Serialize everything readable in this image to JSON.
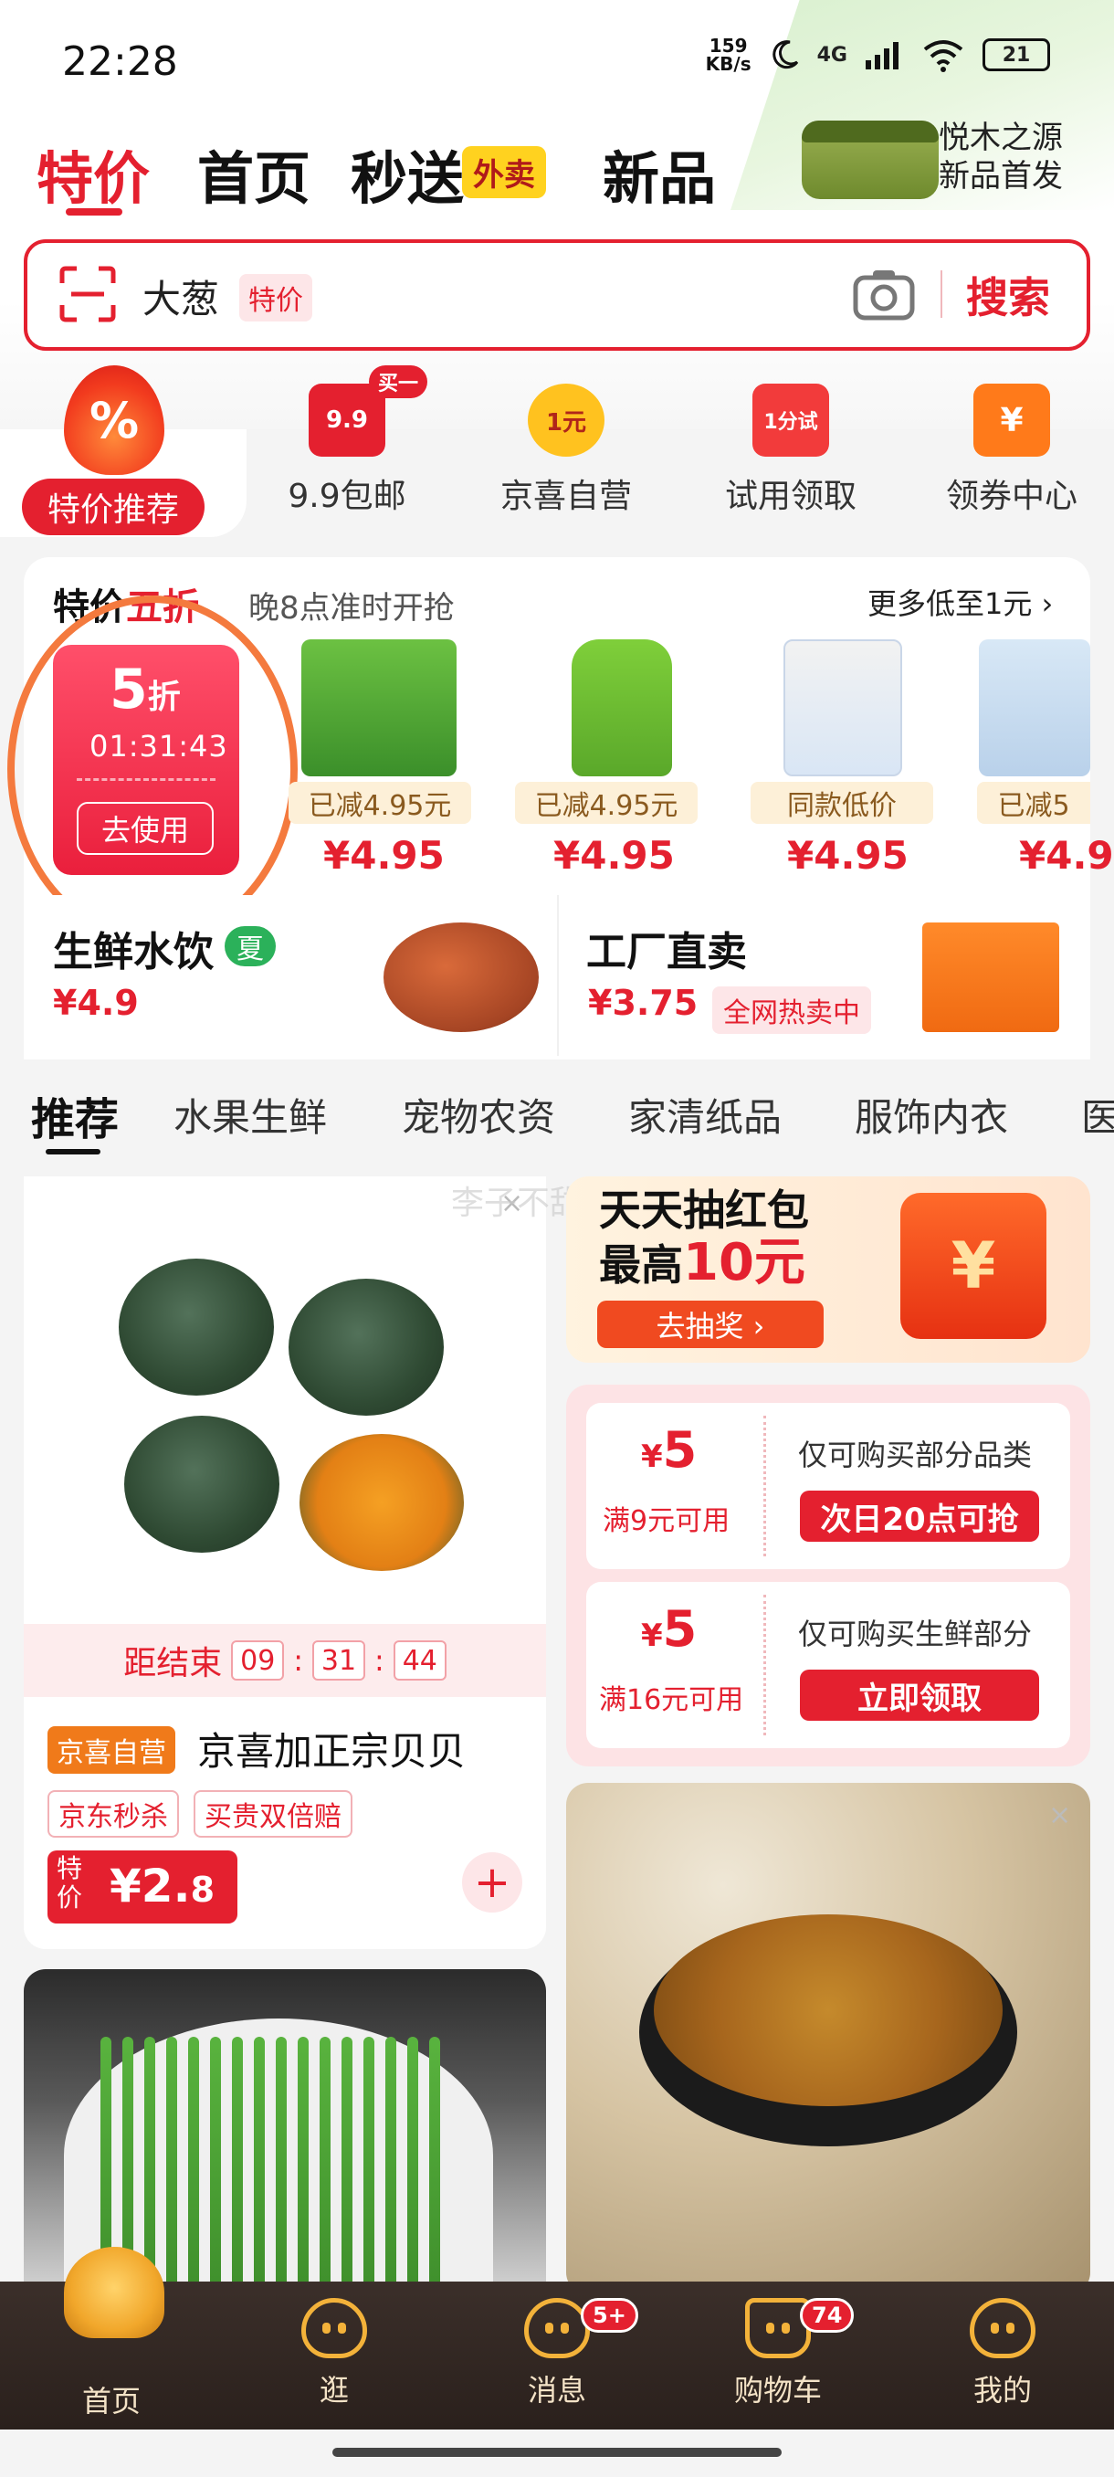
{
  "status_bar": {
    "time": "22:28",
    "speed_value": "159",
    "speed_unit": "KB/s",
    "network": "4G",
    "battery": "21"
  },
  "top_tabs": [
    {
      "label": "特价"
    },
    {
      "label": "首页"
    },
    {
      "label": "秒送"
    },
    {
      "label": "新品"
    }
  ],
  "takeout_badge": "外卖",
  "promo": {
    "line1": "悦木之源",
    "line2": "新品首发"
  },
  "search": {
    "value": "大葱",
    "chip": "特价",
    "button": "搜索"
  },
  "categories": [
    {
      "label": "特价推荐",
      "icon": "flame-percent-icon",
      "icon_text": "%"
    },
    {
      "label": "9.9包邮",
      "icon": "nine-nine-icon",
      "icon_text": "9.9",
      "badge": "买一"
    },
    {
      "label": "京喜自营",
      "icon": "one-yuan-icon",
      "icon_text": "1元"
    },
    {
      "label": "试用领取",
      "icon": "trial-bag-icon",
      "icon_text": "1分试"
    },
    {
      "label": "领券中心",
      "icon": "coupon-center-icon",
      "icon_text": "¥"
    }
  ],
  "flash": {
    "title_black": "特价",
    "title_red": "五折",
    "subtitle": "晚8点准时开抢",
    "more": "更多低至1元 ›",
    "coupon": {
      "discount": "5",
      "discount_unit": "折",
      "timer": "01:31:43",
      "button": "去使用"
    },
    "products": [
      {
        "tag": "已减4.95元",
        "price": "¥4.95",
        "icon": "seaweed-pack-icon"
      },
      {
        "tag": "已减4.95元",
        "price": "¥4.95",
        "icon": "dish-soap-bottle-icon"
      },
      {
        "tag": "同款低价",
        "price": "¥4.95",
        "icon": "toilet-cleaner-icon"
      },
      {
        "tag": "已减5",
        "price": "¥4.9",
        "icon": "tissue-box-icon"
      }
    ]
  },
  "sub_cards": {
    "fresh": {
      "title": "生鲜水饮",
      "season": "夏",
      "price": "¥4.9"
    },
    "factory": {
      "title": "工厂直卖",
      "price": "¥3.75",
      "chip": "全网热卖中"
    }
  },
  "sec_tabs": [
    {
      "label": "推荐"
    },
    {
      "label": "水果生鲜"
    },
    {
      "label": "宠物农资"
    },
    {
      "label": "家清纸品"
    },
    {
      "label": "服饰内衣"
    },
    {
      "label": "医"
    }
  ],
  "watermark": "李子不甜",
  "feed_left": {
    "countdown_label": "距结束",
    "hh": "09",
    "mm": "31",
    "ss": "44",
    "self_tag": "京喜自营",
    "name": "京喜加正宗贝贝",
    "tags": [
      "京东秒杀",
      "买贵双倍赔"
    ],
    "price_prefix": "特价",
    "price_main": "¥2.",
    "price_decimal": "8",
    "add": "+"
  },
  "lottery": {
    "line1": "天天抽红包",
    "line2_prefix": "最高",
    "line2_big": "10元",
    "button": "去抽奖 ›",
    "icon_text": "¥"
  },
  "vouchers": [
    {
      "amount": "5",
      "currency": "¥",
      "cond": "满9元可用",
      "desc": "仅可购买部分品类",
      "button": "次日20点可抢"
    },
    {
      "amount": "5",
      "currency": "¥",
      "cond": "满16元可用",
      "desc": "仅可购买生鲜部分",
      "button": "立即领取"
    }
  ],
  "close": "×",
  "bottom_nav": [
    {
      "label": "首页"
    },
    {
      "label": "逛"
    },
    {
      "label": "消息",
      "badge": "5+"
    },
    {
      "label": "购物车",
      "badge": "74"
    },
    {
      "label": "我的"
    }
  ]
}
